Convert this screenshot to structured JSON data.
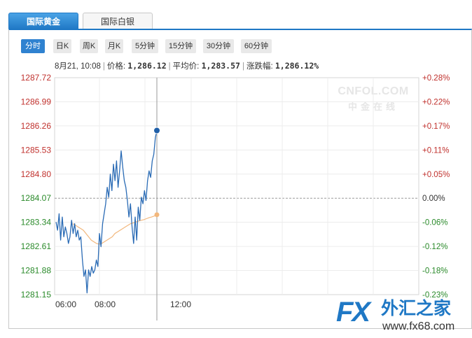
{
  "tabs": [
    {
      "label": "国际黄金",
      "active": true
    },
    {
      "label": "国际白银",
      "active": false
    }
  ],
  "periods": [
    {
      "label": "分时",
      "active": true
    },
    {
      "label": "日K",
      "active": false
    },
    {
      "label": "周K",
      "active": false
    },
    {
      "label": "月K",
      "active": false
    },
    {
      "label": "5分钟",
      "active": false
    },
    {
      "label": "15分钟",
      "active": false
    },
    {
      "label": "30分钟",
      "active": false
    },
    {
      "label": "60分钟",
      "active": false
    }
  ],
  "info": {
    "time": "8月21, 10:08",
    "price_label": "价格:",
    "price": "1,286.12",
    "avg_label": "平均价:",
    "avg": "1,283.57",
    "chg_label": "涨跌幅:",
    "chg": "1,286.12%"
  },
  "watermark": {
    "top": "CNFOL.COM",
    "bottom": "中金在线"
  },
  "logo": {
    "mark": "FX",
    "name": "外汇之家",
    "url": "www.fx68.com"
  },
  "colors": {
    "price_line": "#2a6bb5",
    "avg_line": "#f2b77c",
    "up": "#c0312d",
    "down": "#2a8a2a",
    "accent": "#1f78c5"
  },
  "chart_data": {
    "type": "line",
    "yticks": [
      "1287.72",
      "1286.99",
      "1286.26",
      "1285.53",
      "1284.80",
      "1284.07",
      "1283.34",
      "1282.61",
      "1281.88",
      "1281.15"
    ],
    "right_ticks": [
      "+0.28%",
      "+0.22%",
      "+0.17%",
      "+0.11%",
      "+0.05%",
      "0.00%",
      "-0.06%",
      "-0.12%",
      "-0.18%",
      "-0.23%"
    ],
    "x_ticks": [
      "06:00",
      "08:00",
      "12:00"
    ],
    "ylim": [
      1281.15,
      1287.72
    ],
    "prev_close": 1284.07,
    "grid": true,
    "series": [
      {
        "name": "价格",
        "values": [
          1283.35,
          1283.1,
          1283.6,
          1282.8,
          1283.5,
          1282.9,
          1283.2,
          1283.0,
          1282.7,
          1282.9,
          1283.4,
          1283.0,
          1283.3,
          1282.9,
          1283.1,
          1282.8,
          1282.9,
          1282.2,
          1281.7,
          1281.9,
          1281.2,
          1281.9,
          1281.7,
          1282.0,
          1281.8,
          1281.9,
          1282.2,
          1282.0,
          1283.0,
          1282.6,
          1283.3,
          1283.6,
          1283.9,
          1284.4,
          1284.1,
          1284.8,
          1284.3,
          1285.1,
          1284.6,
          1285.2,
          1284.4,
          1284.9,
          1285.5,
          1285.0,
          1284.6,
          1284.4,
          1284.0,
          1283.5,
          1283.9,
          1283.2,
          1282.7,
          1283.5,
          1282.8,
          1283.8,
          1283.4,
          1284.1,
          1283.9,
          1284.3,
          1284.0,
          1284.6,
          1284.9,
          1284.7,
          1285.2,
          1285.4,
          1285.9,
          1286.12
        ],
        "color": "#2a6bb5"
      },
      {
        "name": "平均价",
        "values": [
          1283.3,
          1283.25,
          1283.2,
          1283.15,
          1283.1,
          1283.0,
          1282.9,
          1282.8,
          1282.75,
          1282.7,
          1282.68,
          1282.7,
          1282.75,
          1282.8,
          1282.85,
          1282.9,
          1283.0,
          1283.05,
          1283.1,
          1283.15,
          1283.2,
          1283.25,
          1283.3,
          1283.32,
          1283.35,
          1283.38,
          1283.4,
          1283.42,
          1283.45,
          1283.48,
          1283.5,
          1283.53,
          1283.57
        ],
        "color": "#f2b77c"
      }
    ]
  }
}
